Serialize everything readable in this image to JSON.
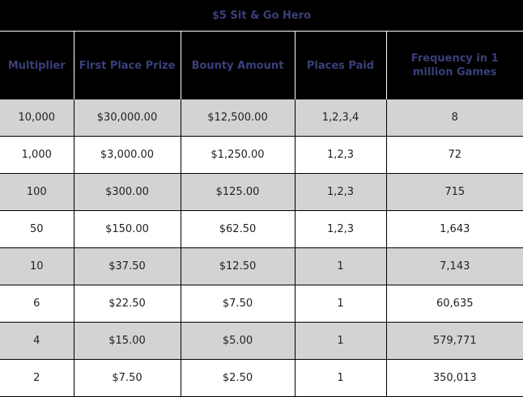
{
  "title": "$5 Sit & Go Hero",
  "headers": [
    "Multiplier",
    "First Place Prize",
    "Bounty Amount",
    "Places Paid",
    "Frequency in 1 million Games"
  ],
  "rows": [
    [
      "10,000",
      "$30,000.00",
      "$12,500.00",
      "1,2,3,4",
      "8"
    ],
    [
      "1,000",
      "$3,000.00",
      "$1,250.00",
      "1,2,3",
      "72"
    ],
    [
      "100",
      "$300.00",
      "$125.00",
      "1,2,3",
      "715"
    ],
    [
      "50",
      "$150.00",
      "$62.50",
      "1,2,3",
      "1,643"
    ],
    [
      "10",
      "$37.50",
      "$12.50",
      "1",
      "7,143"
    ],
    [
      "6",
      "$22.50",
      "$7.50",
      "1",
      "60,635"
    ],
    [
      "4",
      "$15.00",
      "$5.00",
      "1",
      "579,771"
    ],
    [
      "2",
      "$7.50",
      "$2.50",
      "1",
      "350,013"
    ]
  ],
  "colors": {
    "header_bg": "#000000",
    "header_text": "#3b3f7a",
    "row_alt_bg": "#d3d3d3",
    "row_bg": "#ffffff"
  }
}
